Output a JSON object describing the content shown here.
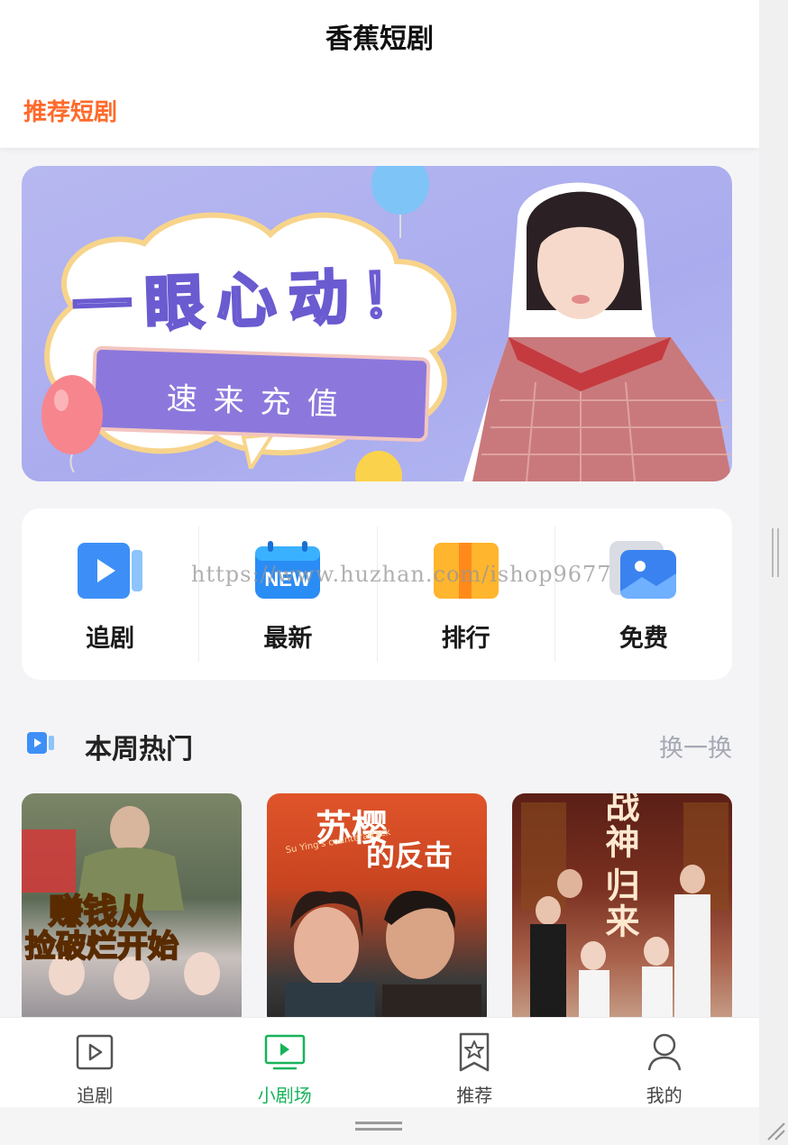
{
  "header": {
    "title": "香蕉短剧",
    "tab_label": "推荐短剧"
  },
  "banner": {
    "headline": "一眼心动！",
    "cta": "速来充值"
  },
  "quick_nav": [
    {
      "label": "追剧",
      "icon": "play-video-icon",
      "color": "#3d8ff7"
    },
    {
      "label": "最新",
      "icon": "new-calendar-icon",
      "color": "#2a8cf5"
    },
    {
      "label": "排行",
      "icon": "ranking-book-icon",
      "color": "#ff9f1a"
    },
    {
      "label": "免费",
      "icon": "free-image-icon",
      "color": "#3a82f0"
    }
  ],
  "watermark": "https://www.huzhan.com/ishop9677",
  "section": {
    "title": "本周热门",
    "refresh_label": "换一换"
  },
  "posters": [
    {
      "title_line1": "赚钱从",
      "title_line2": "捡破烂开始"
    },
    {
      "title_line1": "苏樱",
      "title_line2": "的反击",
      "subtitle": "Su Ying's counterattack"
    },
    {
      "title_line1": "战神",
      "title_line2": "归来"
    }
  ],
  "bottom_nav": [
    {
      "label": "追剧",
      "icon": "play-square-icon",
      "active": false
    },
    {
      "label": "小剧场",
      "icon": "tv-play-icon",
      "active": true
    },
    {
      "label": "推荐",
      "icon": "star-bookmark-icon",
      "active": false
    },
    {
      "label": "我的",
      "icon": "user-icon",
      "active": false
    }
  ],
  "colors": {
    "accent_orange": "#ff6a2b",
    "active_green": "#17b35a",
    "muted_gray": "#a6a9b4"
  }
}
